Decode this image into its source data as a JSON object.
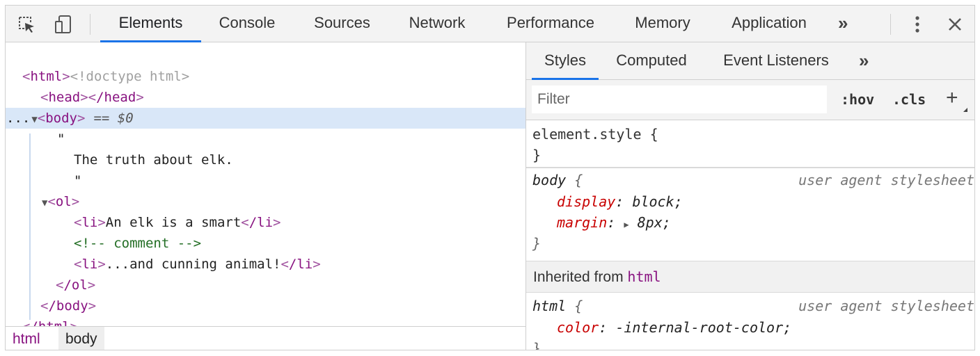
{
  "toolbar": {
    "inspect_icon": "inspect-element-icon",
    "device_icon": "device-toolbar-icon",
    "tabs": [
      {
        "label": "Elements",
        "active": true
      },
      {
        "label": "Console"
      },
      {
        "label": "Sources"
      },
      {
        "label": "Network"
      },
      {
        "label": "Performance"
      },
      {
        "label": "Memory"
      },
      {
        "label": "Application"
      }
    ],
    "more_tabs": "»",
    "menu_icon": "kebab-menu-icon",
    "close_icon": "close-icon"
  },
  "dom": {
    "doctype": "<!doctype html>",
    "html_open_tag": "html",
    "head_open": "head",
    "head_close": "/head",
    "body_tag": "body",
    "selected_marker": "== $0",
    "ellipsis": "...",
    "quote": "\"",
    "text_node": "The truth about elk.",
    "ol_tag": "ol",
    "li1_text": "An elk is a smart",
    "comment": "<!-- comment -->",
    "li2_text": "...and cunning animal!",
    "li_tag": "li",
    "li_close": "/li",
    "ol_close": "/ol",
    "body_close": "/body",
    "html_close": "/html"
  },
  "breadcrumbs": [
    "html",
    "body"
  ],
  "styles": {
    "tabs": [
      {
        "label": "Styles",
        "active": true
      },
      {
        "label": "Computed"
      },
      {
        "label": "Event Listeners"
      }
    ],
    "more_tabs": "»",
    "filter_placeholder": "Filter",
    "hov": ":hov",
    "cls": ".cls",
    "add": "+",
    "element_style": "element.style {",
    "close_brace": "}",
    "body_rule": {
      "selector": "body",
      "source": "user agent stylesheet",
      "props": [
        {
          "name": "display",
          "value": "block"
        },
        {
          "name": "margin",
          "value": "8px"
        }
      ]
    },
    "inherited_label": "Inherited from",
    "inherited_from": "html",
    "html_rule": {
      "selector": "html",
      "source": "user agent stylesheet",
      "props": [
        {
          "name": "color",
          "value": "-internal-root-color"
        }
      ]
    }
  }
}
